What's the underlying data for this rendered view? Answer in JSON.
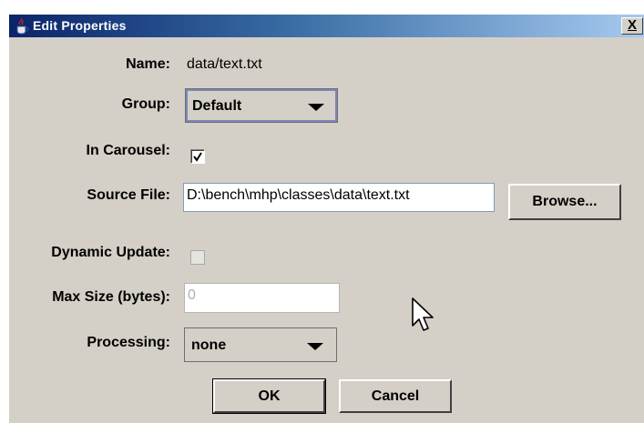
{
  "window": {
    "title": "Edit Properties",
    "close_label": "X"
  },
  "fields": {
    "name_label": "Name:",
    "name_value": "data/text.txt",
    "group_label": "Group:",
    "group_value": "Default",
    "carousel_label": "In Carousel:",
    "carousel_checked": true,
    "source_label": "Source File:",
    "source_value": "D:\\bench\\mhp\\classes\\data\\text.txt",
    "browse_label": "Browse...",
    "dynamic_label": "Dynamic Update:",
    "dynamic_checked": false,
    "maxsize_label": "Max Size (bytes):",
    "maxsize_value": "0",
    "processing_label": "Processing:",
    "processing_value": "none"
  },
  "buttons": {
    "ok": "OK",
    "cancel": "Cancel"
  },
  "icons": {
    "title": "java-cup-icon",
    "dropdown": "chevron-down-icon",
    "check": "checkmark-icon",
    "cursor": "mouse-pointer-icon"
  },
  "colors": {
    "titlebar_start": "#0a246a",
    "titlebar_end": "#a6caf0",
    "dialog_bg": "#d4d0c8"
  }
}
